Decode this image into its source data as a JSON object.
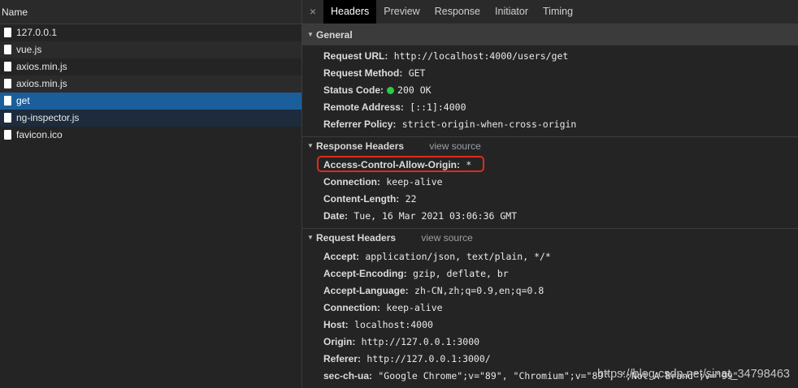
{
  "network": {
    "header": "Name",
    "items": [
      {
        "name": "127.0.0.1"
      },
      {
        "name": "vue.js"
      },
      {
        "name": "axios.min.js"
      },
      {
        "name": "axios.min.js"
      },
      {
        "name": "get"
      },
      {
        "name": "ng-inspector.js"
      },
      {
        "name": "favicon.ico"
      }
    ],
    "selected_index": 4
  },
  "panel": {
    "close_glyph": "×",
    "tabs": [
      "Headers",
      "Preview",
      "Response",
      "Initiator",
      "Timing"
    ],
    "active_tab": "Headers"
  },
  "general": {
    "title": "General",
    "request_url_key": "Request URL:",
    "request_url": "http://localhost:4000/users/get",
    "request_method_key": "Request Method:",
    "request_method": "GET",
    "status_code_key": "Status Code:",
    "status_code": "200 OK",
    "status_color": "#2ec84b",
    "remote_address_key": "Remote Address:",
    "remote_address": "[::1]:4000",
    "referrer_policy_key": "Referrer Policy:",
    "referrer_policy": "strict-origin-when-cross-origin"
  },
  "response_headers": {
    "title": "Response Headers",
    "view_source": "view source",
    "items": [
      {
        "key": "Access-Control-Allow-Origin:",
        "value": "*"
      },
      {
        "key": "Connection:",
        "value": "keep-alive"
      },
      {
        "key": "Content-Length:",
        "value": "22"
      },
      {
        "key": "Date:",
        "value": "Tue, 16 Mar 2021 03:06:36 GMT"
      }
    ]
  },
  "request_headers": {
    "title": "Request Headers",
    "view_source": "view source",
    "items": [
      {
        "key": "Accept:",
        "value": "application/json, text/plain, */*"
      },
      {
        "key": "Accept-Encoding:",
        "value": "gzip, deflate, br"
      },
      {
        "key": "Accept-Language:",
        "value": "zh-CN,zh;q=0.9,en;q=0.8"
      },
      {
        "key": "Connection:",
        "value": "keep-alive"
      },
      {
        "key": "Host:",
        "value": "localhost:4000"
      },
      {
        "key": "Origin:",
        "value": "http://127.0.0.1:3000"
      },
      {
        "key": "Referer:",
        "value": "http://127.0.0.1:3000/"
      },
      {
        "key": "sec-ch-ua:",
        "value": "\"Google Chrome\";v=\"89\", \"Chromium\";v=\"89\", \";Not A Brand\";v=\"99\""
      }
    ]
  },
  "watermark": "https://blog.csdn.net/sinat_34798463",
  "accent": {
    "selected_row": "#1a5f9b",
    "highlight_border": "#e02a1d"
  }
}
